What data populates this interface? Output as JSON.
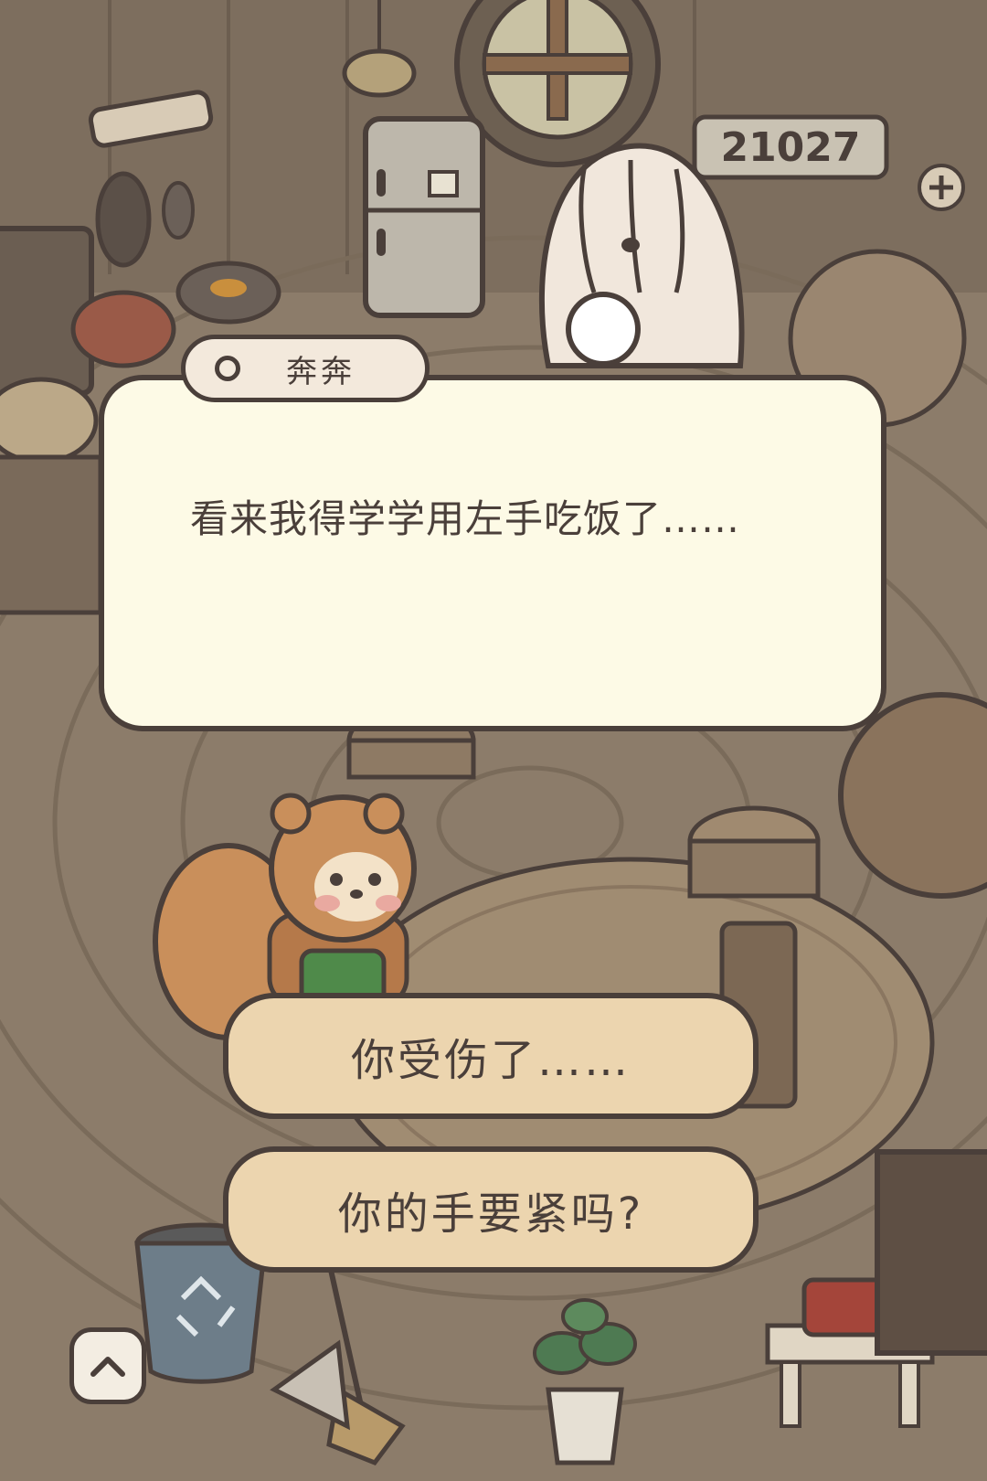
{
  "scene": {
    "counter_value": "21027",
    "palette": {
      "wall": "#7d6e5e",
      "floor": "#8c7c6a",
      "rug": "#a08c72",
      "outline": "#4a3f3a",
      "dialog_bg": "#fdfae6",
      "choice_bg": "#ecd5af",
      "squirrel_fur": "#c98f5b",
      "squirrel_apron": "#4f8a4a"
    },
    "characters": [
      "shaggy-dog-character",
      "squirrel-player-character"
    ]
  },
  "dialog": {
    "speaker_name": "奔奔",
    "text": "看来我得学学用左手吃饭了……"
  },
  "choices": [
    {
      "label": "你受伤了……"
    },
    {
      "label": "你的手要紧吗?"
    }
  ],
  "controls": {
    "up_button_icon": "chevron-up-icon",
    "add_icon": "plus-icon",
    "recycle_icon": "recycle-icon"
  }
}
